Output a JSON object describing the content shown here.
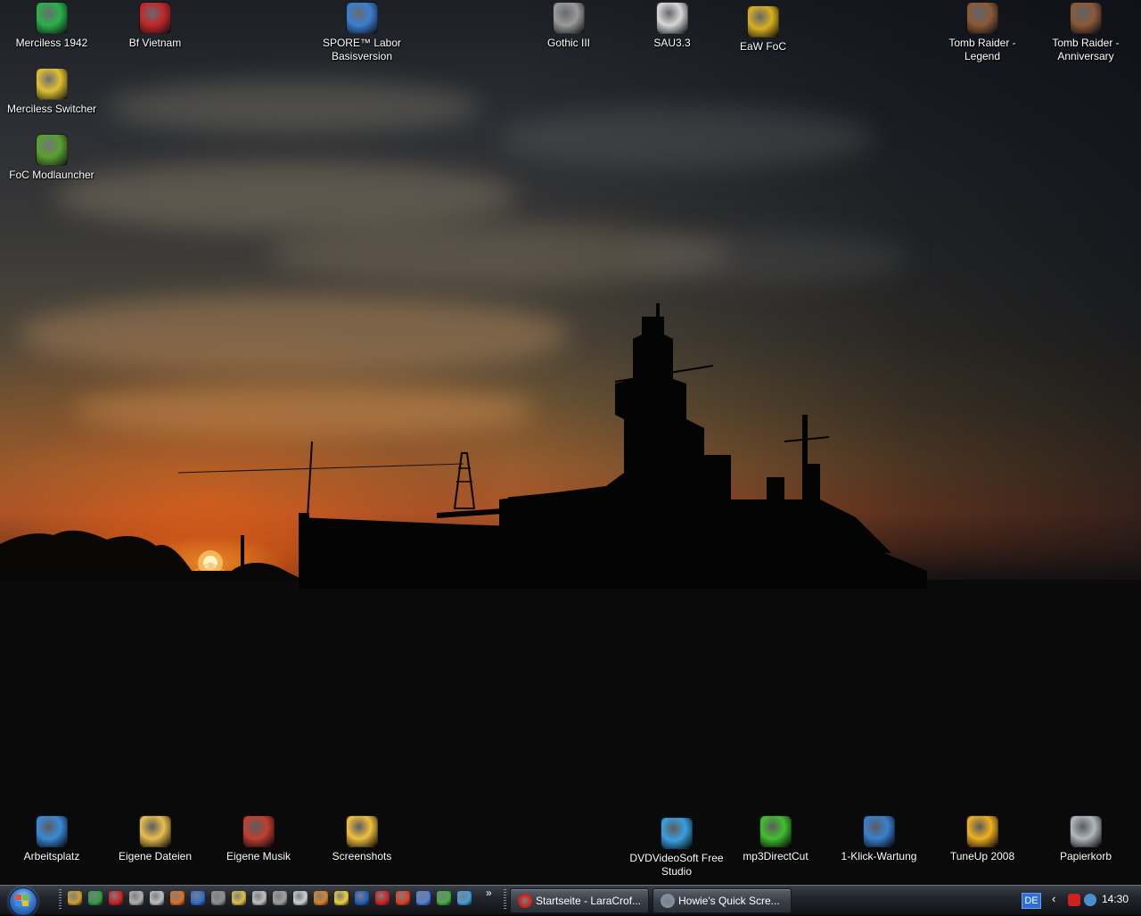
{
  "desktop": {
    "top_icons": [
      {
        "label": "Merciless 1942",
        "icon": "merciless-1942-icon",
        "color": "#2bb24c"
      },
      {
        "label": "Bf Vietnam",
        "icon": "bf-vietnam-icon",
        "color": "#c0282a"
      },
      {
        "label": "SPORE™ Labor Basisversion",
        "icon": "spore-icon",
        "color": "#3b7fd0"
      },
      {
        "label": "Gothic III",
        "icon": "gothic-icon",
        "color": "#9a9a9a"
      },
      {
        "label": "SAU3.3",
        "icon": "sau3-icon",
        "color": "#d8d8d8"
      },
      {
        "label": "EaW FoC",
        "icon": "eaw-foc-icon",
        "color": "#d8b020"
      },
      {
        "label": "Tomb Raider - Legend",
        "icon": "tomb-raider-legend-icon",
        "color": "#8a5a3a"
      },
      {
        "label": "Tomb Raider - Anniversary",
        "icon": "tomb-raider-anniversary-icon",
        "color": "#8a5a3a"
      }
    ],
    "left_icons": [
      {
        "label": "Merciless Switcher",
        "icon": "merciless-switcher-icon",
        "color": "#e0c030"
      },
      {
        "label": "FoC Modlauncher",
        "icon": "foc-modlauncher-icon",
        "color": "#5aa030"
      }
    ],
    "bottom_icons": [
      {
        "label": "Arbeitsplatz",
        "icon": "computer-icon",
        "color": "#3a8ad8"
      },
      {
        "label": "Eigene Dateien",
        "icon": "my-documents-icon",
        "color": "#e8c050"
      },
      {
        "label": "Eigene Musik",
        "icon": "my-music-icon",
        "color": "#c04030"
      },
      {
        "label": "Screenshots",
        "icon": "folder-icon",
        "color": "#f0c040"
      },
      {
        "label": "DVDVideoSoft Free Studio",
        "icon": "dvdvideosoft-icon",
        "color": "#3aa0e0"
      },
      {
        "label": "mp3DirectCut",
        "icon": "mp3directcut-icon",
        "color": "#40c030"
      },
      {
        "label": "1-Klick-Wartung",
        "icon": "one-click-maintenance-icon",
        "color": "#3a80d0"
      },
      {
        "label": "TuneUp 2008",
        "icon": "tuneup-icon",
        "color": "#f0b020"
      },
      {
        "label": "Papierkorb",
        "icon": "recycle-bin-icon",
        "color": "#b0b8c0"
      }
    ]
  },
  "taskbar": {
    "tasks": [
      {
        "label": "Startseite - LaraCrof...",
        "icon": "opera-icon",
        "color": "#d02020"
      },
      {
        "label": "Howie's Quick Scre...",
        "icon": "camera-icon",
        "color": "#8090a0"
      }
    ],
    "language": "DE",
    "more_glyph": "»",
    "tray_arrow": "‹",
    "clock": "14:30"
  }
}
